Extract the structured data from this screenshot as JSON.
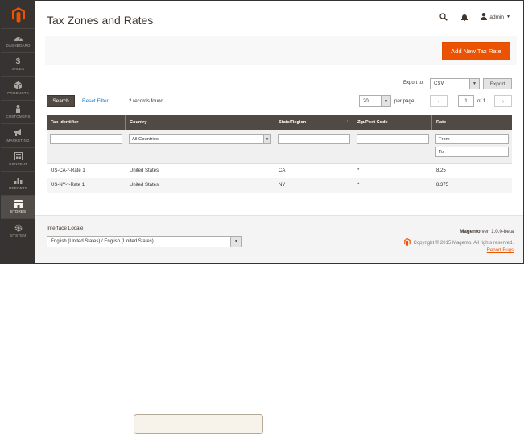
{
  "sidebar": {
    "items": [
      {
        "label": "DASHBOARD",
        "icon": "dashboard-icon"
      },
      {
        "label": "SALES",
        "icon": "dollar-icon"
      },
      {
        "label": "PRODUCTS",
        "icon": "cube-icon"
      },
      {
        "label": "CUSTOMERS",
        "icon": "person-icon"
      },
      {
        "label": "MARKETING",
        "icon": "megaphone-icon"
      },
      {
        "label": "CONTENT",
        "icon": "content-icon"
      },
      {
        "label": "REPORTS",
        "icon": "bar-chart-icon"
      },
      {
        "label": "STORES",
        "icon": "store-icon"
      },
      {
        "label": "SYSTEM",
        "icon": "gear-icon"
      }
    ],
    "active_index": 7
  },
  "header": {
    "title": "Tax Zones and Rates",
    "user": "admin"
  },
  "actions": {
    "add_label": "Add New Tax Rate"
  },
  "export": {
    "label": "Export to:",
    "format": "CSV",
    "button": "Export"
  },
  "toolbar": {
    "search_label": "Search",
    "reset_label": "Reset Filter",
    "records": "2 records found",
    "per_page_value": "20",
    "per_page_label": "per page",
    "page_value": "1",
    "of_label": "of 1"
  },
  "grid": {
    "columns": [
      "Tax Identifier",
      "Country",
      "State/Region",
      "Zip/Post Code",
      "Rate"
    ],
    "filters": {
      "country": "All Countries",
      "rate_from": "From",
      "rate_to": "To"
    },
    "rows": [
      [
        "US-CA-*-Rate 1",
        "United States",
        "CA",
        "*",
        "8.25"
      ],
      [
        "US-NY-*-Rate 1",
        "United States",
        "NY",
        "*",
        "8.375"
      ]
    ]
  },
  "footer": {
    "locale_label": "Interface Locale",
    "locale_value": "English (United States) / English (United States)",
    "brand": "Magento",
    "version": "ver. 1.0.0-beta",
    "copyright": "Copyright © 2015 Magento. All rights reserved.",
    "report": "Report Bugs"
  },
  "colors": {
    "accent": "#eb5202",
    "sidebar": "#373330",
    "grid_header": "#514943",
    "link": "#1979c3"
  }
}
